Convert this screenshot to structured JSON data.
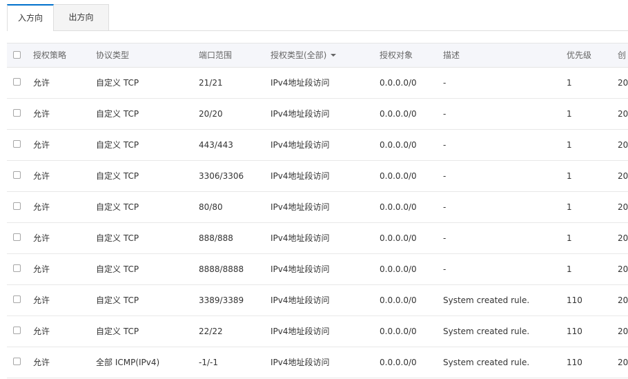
{
  "tabs": [
    {
      "label": "入方向",
      "active": true
    },
    {
      "label": "出方向",
      "active": false
    }
  ],
  "columns": {
    "policy": "授权策略",
    "protocol": "协议类型",
    "port_range": "端口范围",
    "auth_type": "授权类型(全部)",
    "auth_object": "授权对象",
    "description": "描述",
    "priority": "优先级",
    "created": "创"
  },
  "rows": [
    {
      "policy": "允许",
      "protocol": "自定义 TCP",
      "port_range": "21/21",
      "auth_type": "IPv4地址段访问",
      "auth_object": "0.0.0.0/0",
      "description": "-",
      "priority": "1",
      "created": "20"
    },
    {
      "policy": "允许",
      "protocol": "自定义 TCP",
      "port_range": "20/20",
      "auth_type": "IPv4地址段访问",
      "auth_object": "0.0.0.0/0",
      "description": "-",
      "priority": "1",
      "created": "20"
    },
    {
      "policy": "允许",
      "protocol": "自定义 TCP",
      "port_range": "443/443",
      "auth_type": "IPv4地址段访问",
      "auth_object": "0.0.0.0/0",
      "description": "-",
      "priority": "1",
      "created": "20"
    },
    {
      "policy": "允许",
      "protocol": "自定义 TCP",
      "port_range": "3306/3306",
      "auth_type": "IPv4地址段访问",
      "auth_object": "0.0.0.0/0",
      "description": "-",
      "priority": "1",
      "created": "20"
    },
    {
      "policy": "允许",
      "protocol": "自定义 TCP",
      "port_range": "80/80",
      "auth_type": "IPv4地址段访问",
      "auth_object": "0.0.0.0/0",
      "description": "-",
      "priority": "1",
      "created": "20"
    },
    {
      "policy": "允许",
      "protocol": "自定义 TCP",
      "port_range": "888/888",
      "auth_type": "IPv4地址段访问",
      "auth_object": "0.0.0.0/0",
      "description": "-",
      "priority": "1",
      "created": "20"
    },
    {
      "policy": "允许",
      "protocol": "自定义 TCP",
      "port_range": "8888/8888",
      "auth_type": "IPv4地址段访问",
      "auth_object": "0.0.0.0/0",
      "description": "-",
      "priority": "1",
      "created": "20"
    },
    {
      "policy": "允许",
      "protocol": "自定义 TCP",
      "port_range": "3389/3389",
      "auth_type": "IPv4地址段访问",
      "auth_object": "0.0.0.0/0",
      "description": "System created rule.",
      "priority": "110",
      "created": "20"
    },
    {
      "policy": "允许",
      "protocol": "自定义 TCP",
      "port_range": "22/22",
      "auth_type": "IPv4地址段访问",
      "auth_object": "0.0.0.0/0",
      "description": "System created rule.",
      "priority": "110",
      "created": "20"
    },
    {
      "policy": "允许",
      "protocol": "全部 ICMP(IPv4)",
      "port_range": "-1/-1",
      "auth_type": "IPv4地址段访问",
      "auth_object": "0.0.0.0/0",
      "description": "System created rule.",
      "priority": "110",
      "created": "20"
    }
  ]
}
